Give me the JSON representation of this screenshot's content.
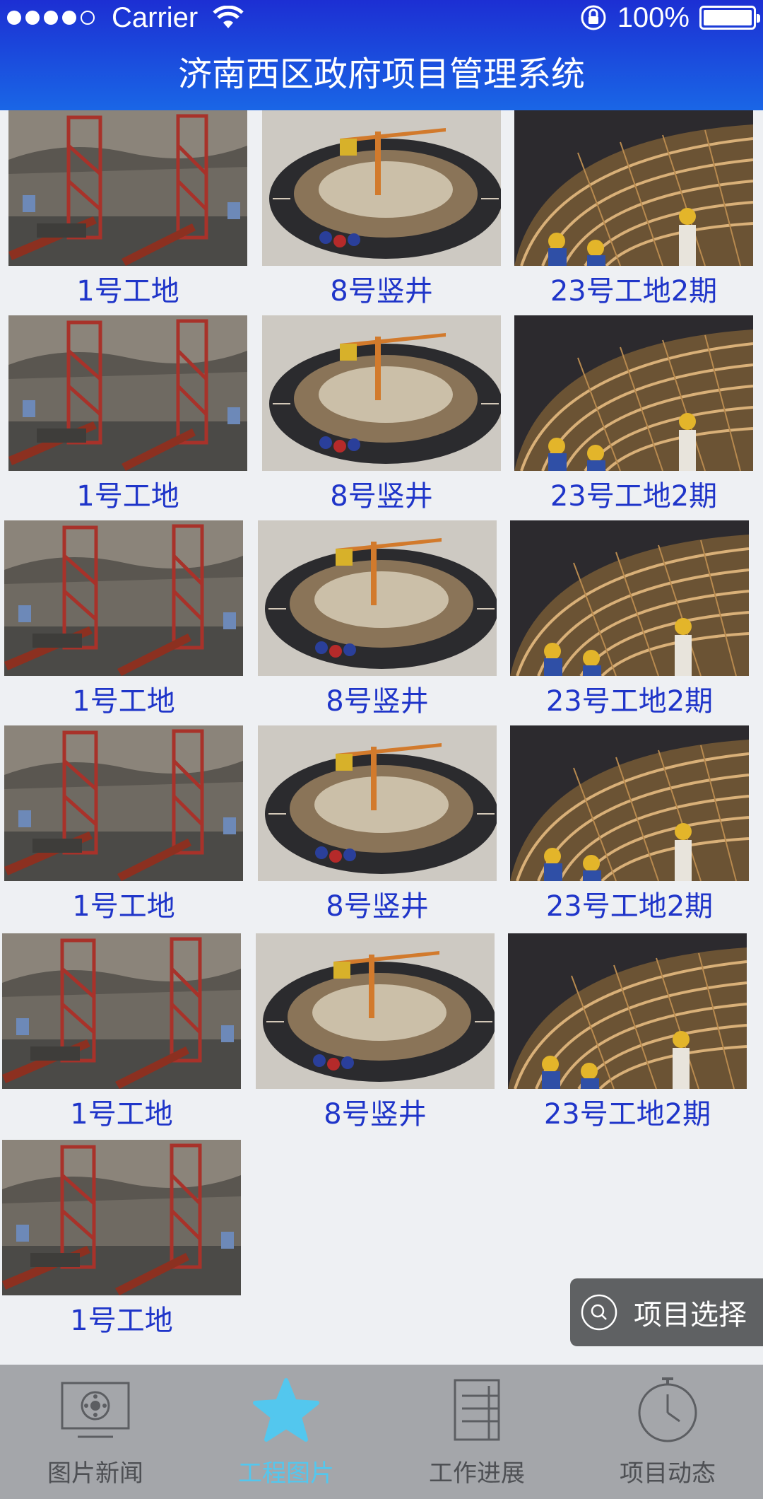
{
  "status_bar": {
    "carrier": "Carrier",
    "battery": "100%"
  },
  "header": {
    "title": "济南西区政府项目管理系统"
  },
  "grid": {
    "rows": [
      [
        "1号工地",
        "8号竖井",
        "23号工地2期"
      ],
      [
        "1号工地",
        "8号竖井",
        "23号工地2期"
      ],
      [
        "1号工地",
        "8号竖井",
        "23号工地2期"
      ],
      [
        "1号工地",
        "8号竖井",
        "23号工地2期"
      ],
      [
        "1号工地",
        "8号竖井",
        "23号工地2期"
      ],
      [
        "1号工地"
      ]
    ]
  },
  "floating_button": {
    "label": "项目选择",
    "icon": "search-icon"
  },
  "tabbar": {
    "tabs": [
      {
        "label": "图片新闻",
        "icon": "monitor-icon",
        "active": false
      },
      {
        "label": "工程图片",
        "icon": "star-icon",
        "active": true
      },
      {
        "label": "工作进展",
        "icon": "document-icon",
        "active": false
      },
      {
        "label": "项目动态",
        "icon": "clock-icon",
        "active": false
      }
    ]
  },
  "colors": {
    "header_start": "#1c2fd3",
    "header_end": "#1a66e6",
    "label_blue": "#1f35c9",
    "tab_active": "#53c7ee",
    "tabbar_bg": "#a4a6aa"
  }
}
